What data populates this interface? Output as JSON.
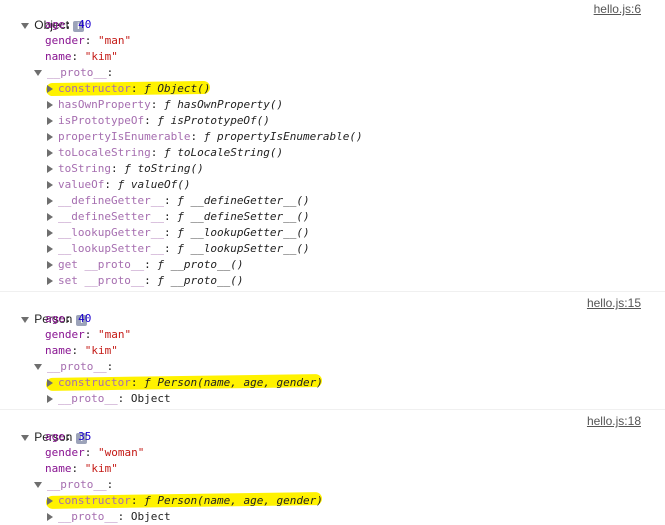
{
  "icons": {
    "info": "info-icon",
    "expand": "triangle-down-icon",
    "collapse": "triangle-right-icon"
  },
  "colors": {
    "key": "#881391",
    "number": "#1c00cf",
    "string": "#c41a16",
    "highlight": "#fff200"
  },
  "entries": [
    {
      "label": "Object",
      "info": "i",
      "source": "hello.js:6",
      "props": [
        {
          "key": "age",
          "sep": ": ",
          "value": "40"
        },
        {
          "key": "gender",
          "sep": ": ",
          "value": "\"man\""
        },
        {
          "key": "name",
          "sep": ": ",
          "value": "\"kim\""
        }
      ],
      "proto_label": "__proto__",
      "proto_sep": ":",
      "proto_items": [
        {
          "key": "constructor",
          "sep": ": ",
          "value": "ƒ Object()"
        },
        {
          "key": "hasOwnProperty",
          "sep": ": ",
          "value": "ƒ hasOwnProperty()"
        },
        {
          "key": "isPrototypeOf",
          "sep": ": ",
          "value": "ƒ isPrototypeOf()"
        },
        {
          "key": "propertyIsEnumerable",
          "sep": ": ",
          "value": "ƒ propertyIsEnumerable()"
        },
        {
          "key": "toLocaleString",
          "sep": ": ",
          "value": "ƒ toLocaleString()"
        },
        {
          "key": "toString",
          "sep": ": ",
          "value": "ƒ toString()"
        },
        {
          "key": "valueOf",
          "sep": ": ",
          "value": "ƒ valueOf()"
        },
        {
          "key": "__defineGetter__",
          "sep": ": ",
          "value": "ƒ __defineGetter__()"
        },
        {
          "key": "__defineSetter__",
          "sep": ": ",
          "value": "ƒ __defineSetter__()"
        },
        {
          "key": "__lookupGetter__",
          "sep": ": ",
          "value": "ƒ __lookupGetter__()"
        },
        {
          "key": "__lookupSetter__",
          "sep": ": ",
          "value": "ƒ __lookupSetter__()"
        },
        {
          "key": "get __proto__",
          "sep": ": ",
          "value": "ƒ __proto__()"
        },
        {
          "key": "set __proto__",
          "sep": ": ",
          "value": "ƒ __proto__()"
        }
      ]
    },
    {
      "label": "Person",
      "info": "i",
      "source": "hello.js:15",
      "props": [
        {
          "key": "age",
          "sep": ": ",
          "value": "40"
        },
        {
          "key": "gender",
          "sep": ": ",
          "value": "\"man\""
        },
        {
          "key": "name",
          "sep": ": ",
          "value": "\"kim\""
        }
      ],
      "proto_label": "__proto__",
      "proto_sep": ":",
      "proto_items": [
        {
          "key": "constructor",
          "sep": ": ",
          "value": "ƒ Person(name, age, gender)"
        },
        {
          "key": "__proto__",
          "sep": ": ",
          "value": "Object"
        }
      ]
    },
    {
      "label": "Person",
      "info": "i",
      "source": "hello.js:18",
      "props": [
        {
          "key": "age",
          "sep": ": ",
          "value": "35"
        },
        {
          "key": "gender",
          "sep": ": ",
          "value": "\"woman\""
        },
        {
          "key": "name",
          "sep": ": ",
          "value": "\"kim\""
        }
      ],
      "proto_label": "__proto__",
      "proto_sep": ":",
      "proto_items": [
        {
          "key": "constructor",
          "sep": ": ",
          "value": "ƒ Person(name, age, gender)"
        },
        {
          "key": "__proto__",
          "sep": ": ",
          "value": "Object"
        }
      ]
    }
  ]
}
